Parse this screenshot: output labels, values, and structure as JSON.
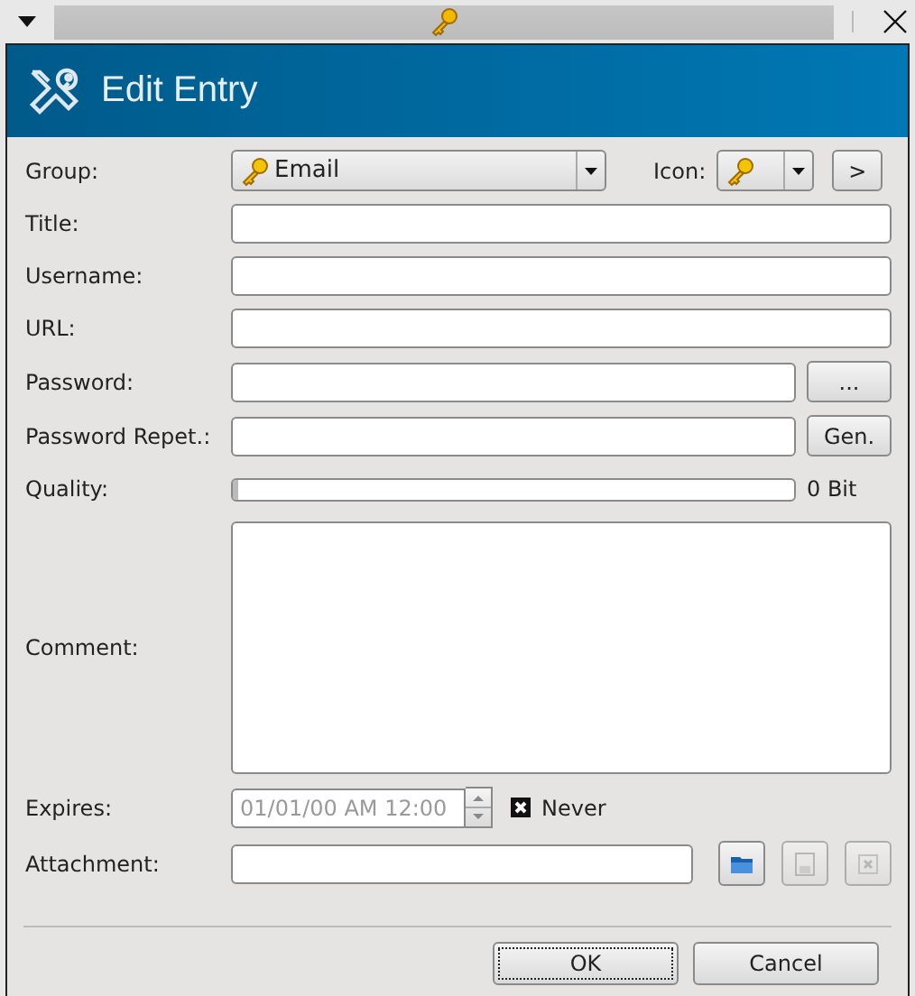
{
  "header": {
    "title": "Edit Entry"
  },
  "rows": [
    {
      "kind": "group",
      "label": "Group:",
      "value": "Email",
      "icon_label": "Icon:",
      "button": ">"
    },
    {
      "kind": "text",
      "label": "Title:"
    },
    {
      "kind": "text",
      "label": "Username:"
    },
    {
      "kind": "text",
      "label": "URL:"
    },
    {
      "kind": "password",
      "label": "Password:",
      "button": "..."
    },
    {
      "kind": "password",
      "label": "Password Repet.:",
      "button": "Gen."
    },
    {
      "kind": "quality",
      "label": "Quality:",
      "level": 0,
      "reading": "0 Bit"
    },
    {
      "kind": "comment",
      "label": "Comment:"
    },
    {
      "kind": "expires",
      "label": "Expires:",
      "value": "01/01/00 AM 12:00",
      "disabled": true,
      "checkbox": {
        "label": "Never",
        "checked": true
      }
    },
    {
      "kind": "attachment",
      "label": "Attachment:",
      "buttons": [
        {
          "kind": "open",
          "disabled": false
        },
        {
          "kind": "save",
          "disabled": true
        },
        {
          "kind": "delete",
          "disabled": true
        }
      ]
    }
  ],
  "buttons": [
    {
      "label": "OK",
      "focused": true
    },
    {
      "label": "Cancel",
      "focused": false
    }
  ]
}
